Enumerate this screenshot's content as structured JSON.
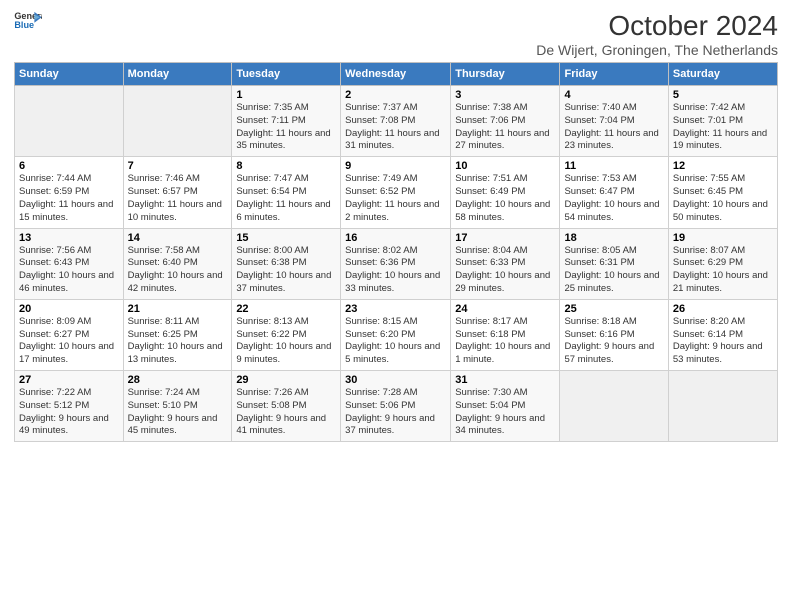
{
  "header": {
    "logo_line1": "General",
    "logo_line2": "Blue",
    "title": "October 2024",
    "subtitle": "De Wijert, Groningen, The Netherlands"
  },
  "days_of_week": [
    "Sunday",
    "Monday",
    "Tuesday",
    "Wednesday",
    "Thursday",
    "Friday",
    "Saturday"
  ],
  "weeks": [
    [
      {
        "num": "",
        "info": ""
      },
      {
        "num": "",
        "info": ""
      },
      {
        "num": "1",
        "info": "Sunrise: 7:35 AM\nSunset: 7:11 PM\nDaylight: 11 hours and 35 minutes."
      },
      {
        "num": "2",
        "info": "Sunrise: 7:37 AM\nSunset: 7:08 PM\nDaylight: 11 hours and 31 minutes."
      },
      {
        "num": "3",
        "info": "Sunrise: 7:38 AM\nSunset: 7:06 PM\nDaylight: 11 hours and 27 minutes."
      },
      {
        "num": "4",
        "info": "Sunrise: 7:40 AM\nSunset: 7:04 PM\nDaylight: 11 hours and 23 minutes."
      },
      {
        "num": "5",
        "info": "Sunrise: 7:42 AM\nSunset: 7:01 PM\nDaylight: 11 hours and 19 minutes."
      }
    ],
    [
      {
        "num": "6",
        "info": "Sunrise: 7:44 AM\nSunset: 6:59 PM\nDaylight: 11 hours and 15 minutes."
      },
      {
        "num": "7",
        "info": "Sunrise: 7:46 AM\nSunset: 6:57 PM\nDaylight: 11 hours and 10 minutes."
      },
      {
        "num": "8",
        "info": "Sunrise: 7:47 AM\nSunset: 6:54 PM\nDaylight: 11 hours and 6 minutes."
      },
      {
        "num": "9",
        "info": "Sunrise: 7:49 AM\nSunset: 6:52 PM\nDaylight: 11 hours and 2 minutes."
      },
      {
        "num": "10",
        "info": "Sunrise: 7:51 AM\nSunset: 6:49 PM\nDaylight: 10 hours and 58 minutes."
      },
      {
        "num": "11",
        "info": "Sunrise: 7:53 AM\nSunset: 6:47 PM\nDaylight: 10 hours and 54 minutes."
      },
      {
        "num": "12",
        "info": "Sunrise: 7:55 AM\nSunset: 6:45 PM\nDaylight: 10 hours and 50 minutes."
      }
    ],
    [
      {
        "num": "13",
        "info": "Sunrise: 7:56 AM\nSunset: 6:43 PM\nDaylight: 10 hours and 46 minutes."
      },
      {
        "num": "14",
        "info": "Sunrise: 7:58 AM\nSunset: 6:40 PM\nDaylight: 10 hours and 42 minutes."
      },
      {
        "num": "15",
        "info": "Sunrise: 8:00 AM\nSunset: 6:38 PM\nDaylight: 10 hours and 37 minutes."
      },
      {
        "num": "16",
        "info": "Sunrise: 8:02 AM\nSunset: 6:36 PM\nDaylight: 10 hours and 33 minutes."
      },
      {
        "num": "17",
        "info": "Sunrise: 8:04 AM\nSunset: 6:33 PM\nDaylight: 10 hours and 29 minutes."
      },
      {
        "num": "18",
        "info": "Sunrise: 8:05 AM\nSunset: 6:31 PM\nDaylight: 10 hours and 25 minutes."
      },
      {
        "num": "19",
        "info": "Sunrise: 8:07 AM\nSunset: 6:29 PM\nDaylight: 10 hours and 21 minutes."
      }
    ],
    [
      {
        "num": "20",
        "info": "Sunrise: 8:09 AM\nSunset: 6:27 PM\nDaylight: 10 hours and 17 minutes."
      },
      {
        "num": "21",
        "info": "Sunrise: 8:11 AM\nSunset: 6:25 PM\nDaylight: 10 hours and 13 minutes."
      },
      {
        "num": "22",
        "info": "Sunrise: 8:13 AM\nSunset: 6:22 PM\nDaylight: 10 hours and 9 minutes."
      },
      {
        "num": "23",
        "info": "Sunrise: 8:15 AM\nSunset: 6:20 PM\nDaylight: 10 hours and 5 minutes."
      },
      {
        "num": "24",
        "info": "Sunrise: 8:17 AM\nSunset: 6:18 PM\nDaylight: 10 hours and 1 minute."
      },
      {
        "num": "25",
        "info": "Sunrise: 8:18 AM\nSunset: 6:16 PM\nDaylight: 9 hours and 57 minutes."
      },
      {
        "num": "26",
        "info": "Sunrise: 8:20 AM\nSunset: 6:14 PM\nDaylight: 9 hours and 53 minutes."
      }
    ],
    [
      {
        "num": "27",
        "info": "Sunrise: 7:22 AM\nSunset: 5:12 PM\nDaylight: 9 hours and 49 minutes."
      },
      {
        "num": "28",
        "info": "Sunrise: 7:24 AM\nSunset: 5:10 PM\nDaylight: 9 hours and 45 minutes."
      },
      {
        "num": "29",
        "info": "Sunrise: 7:26 AM\nSunset: 5:08 PM\nDaylight: 9 hours and 41 minutes."
      },
      {
        "num": "30",
        "info": "Sunrise: 7:28 AM\nSunset: 5:06 PM\nDaylight: 9 hours and 37 minutes."
      },
      {
        "num": "31",
        "info": "Sunrise: 7:30 AM\nSunset: 5:04 PM\nDaylight: 9 hours and 34 minutes."
      },
      {
        "num": "",
        "info": ""
      },
      {
        "num": "",
        "info": ""
      }
    ]
  ]
}
